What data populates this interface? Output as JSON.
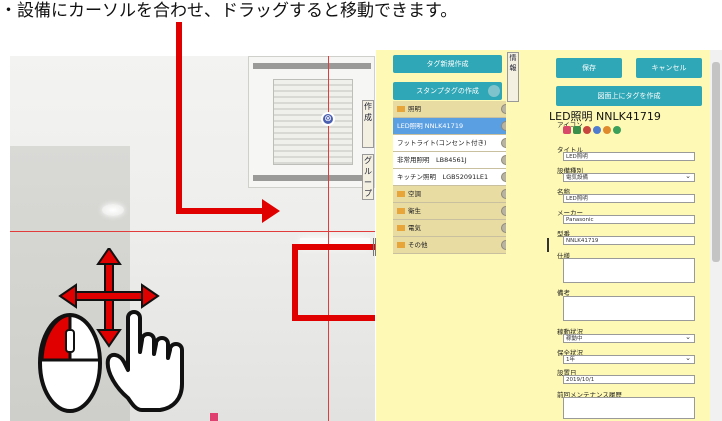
{
  "caption": "・設備にカーソルを合わせ、ドラッグすると移動できます。",
  "viewer": {
    "marker_glyph": "⊗"
  },
  "side_tabs": [
    {
      "label": "作成"
    },
    {
      "label": "グループ"
    }
  ],
  "stamp_panel": {
    "new_button": "タグ新規作成",
    "create_button": "スタンプタグの作成",
    "rows": [
      {
        "type": "folder",
        "label": "照明"
      },
      {
        "type": "item",
        "label": "LED照明 NNLK41719",
        "selected": true
      },
      {
        "type": "item",
        "label": "フットライト(コンセント付き)"
      },
      {
        "type": "item",
        "label": "非常用照明　LB84561J"
      },
      {
        "type": "item",
        "label": "キッチン照明　LGB52091LE1"
      },
      {
        "type": "folder",
        "label": "空調"
      },
      {
        "type": "folder",
        "label": "衛生"
      },
      {
        "type": "folder",
        "label": "電気"
      },
      {
        "type": "folder",
        "label": "その他"
      }
    ]
  },
  "properties": {
    "tab_label": "情報",
    "save_button": "保存",
    "cancel_button": "キャンセル",
    "plan_button": "図面上にタグを作成",
    "heading": "LED照明 NNLK41719",
    "icon_label": "アイコン",
    "icon_colors": [
      "#d94a6a",
      "#3a8f4a",
      "#c7463e",
      "#4f7ccf",
      "#e08a2e",
      "#3aa05a"
    ],
    "fields": {
      "title_label": "タイトル",
      "title_value": "LED照明",
      "equipment_label": "設備種別",
      "equipment_value": "電気設備",
      "name_label": "名称",
      "name_value": "LED照明",
      "maker_label": "メーカー",
      "maker_value": "Panasonic",
      "model_label": "型番",
      "model_value": "NNLK41719",
      "spec_label": "仕様",
      "note_label": "備考",
      "status_label": "稼動状況",
      "status_value": "稼動中",
      "warranty_label": "保全状況",
      "warranty_value": "1年",
      "install_label": "設置日",
      "install_value": "2019/10/1",
      "maintenance_label": "前回メンテナンス履歴"
    }
  }
}
